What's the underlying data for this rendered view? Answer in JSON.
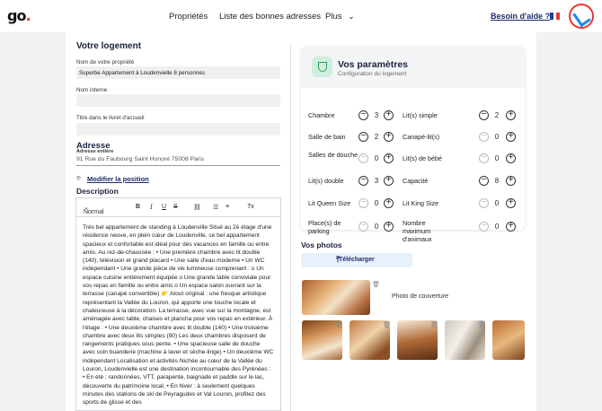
{
  "header": {
    "logo": "go",
    "nav": [
      "Propriétés",
      "Liste des bonnes adresses",
      "Plus"
    ],
    "help": "Besoin d'aide ?",
    "colors": {
      "accent": "#e53935",
      "brand": "#1d2a6b"
    }
  },
  "logement": {
    "title": "Votre logement",
    "name_label": "Nom de votre propriété",
    "name_value": "Superbe Appartement à Loudenvielle 8 personnes",
    "internal_label": "Nom interne",
    "internal_value": "",
    "booklet_label": "Titre dans le livret d'accueil",
    "booklet_value": "",
    "address_title": "Adresse",
    "address_label": "Adresse entière",
    "address_value": "91 Rue du Faubourg Saint Honoré 75008 Paris",
    "modify_link": "Modifier la position",
    "description_title": "Description",
    "editor_style": "Normal",
    "description": "Très bel appartement de standing à Loudenville Situé au 2è étage d'une résidence neuve, en plein cœur de Loudenville, ce bel appartement spacieux et confortable est idéal pour des vacances en famille ou entre amis. Au rez-de-chaussée : • Une première chambre avec lit double (140), télévision et grand placard • Une salle d'eau moderne • Un WC indépendant • Une grande pièce de vie lumineuse comprenant : o Un espace cuisine entièrement équipée o Une grande table conviviale pour vos repas en famille ou entre amis o Un espace salon ouvrant sur la terrasse (canapé convertible) 👉 Atout original : une fresque artistique représentant la Vallée du Louron, qui apporte une touche locale et chaleureuse à la décoration. La terrasse, avec vue sur la montagne, est aménagée avec table, chaises et plancha pour vos repas en extérieur. À l'étage : • Une deuxième chambre avec lit double (140) • Une troisième chambre avec deux lits simples (90) Les deux chambres disposent de rangements pratiques sous pente. • Une spacieuse salle de douche avec coin buanderie (machine à laver et sèche-linge) • Un deuxième WC indépendant Localisation et activités Nichée au cœur de la Vallée du Louron, Loudenvielle est une destination incontournable des Pyrénées : • En été : randonnées, VTT, parapente, baignade et paddle sur le lac, découverte du patrimoine local. • En hiver : à seulement quelques minutes des stations de ski de Peyragudes et Val Louron, profitez des sports de glisse et des"
  },
  "params": {
    "title": "Vos paramètres",
    "subtitle": "Configuration du logement",
    "left": [
      {
        "label": "Chambre",
        "value": "3",
        "min": false
      },
      {
        "label": "Salle de bain",
        "value": "2",
        "min": false
      },
      {
        "label": "Salles de douche",
        "value": "0",
        "min": true
      },
      {
        "label": "Lit(s) double",
        "value": "3",
        "min": false
      },
      {
        "label": "Lit Queen Size",
        "value": "0",
        "min": true
      },
      {
        "label": "Place(s) de parking",
        "value": "0",
        "min": true
      }
    ],
    "right": [
      {
        "label": "Lit(s) simple",
        "value": "2",
        "min": false
      },
      {
        "label": "Canapé-lit(s)",
        "value": "0",
        "min": true
      },
      {
        "label": "Lit(s) de bébé",
        "value": "0",
        "min": true
      },
      {
        "label": "Capacité",
        "value": "8",
        "min": false
      },
      {
        "label": "Lit King Size",
        "value": "0",
        "min": true
      },
      {
        "label": "Nombre maximum d'animaux",
        "value": "0",
        "min": true
      }
    ]
  },
  "photos": {
    "title": "Vos photos",
    "upload": "Télécharger",
    "cover_label": "Photo de couverture"
  }
}
